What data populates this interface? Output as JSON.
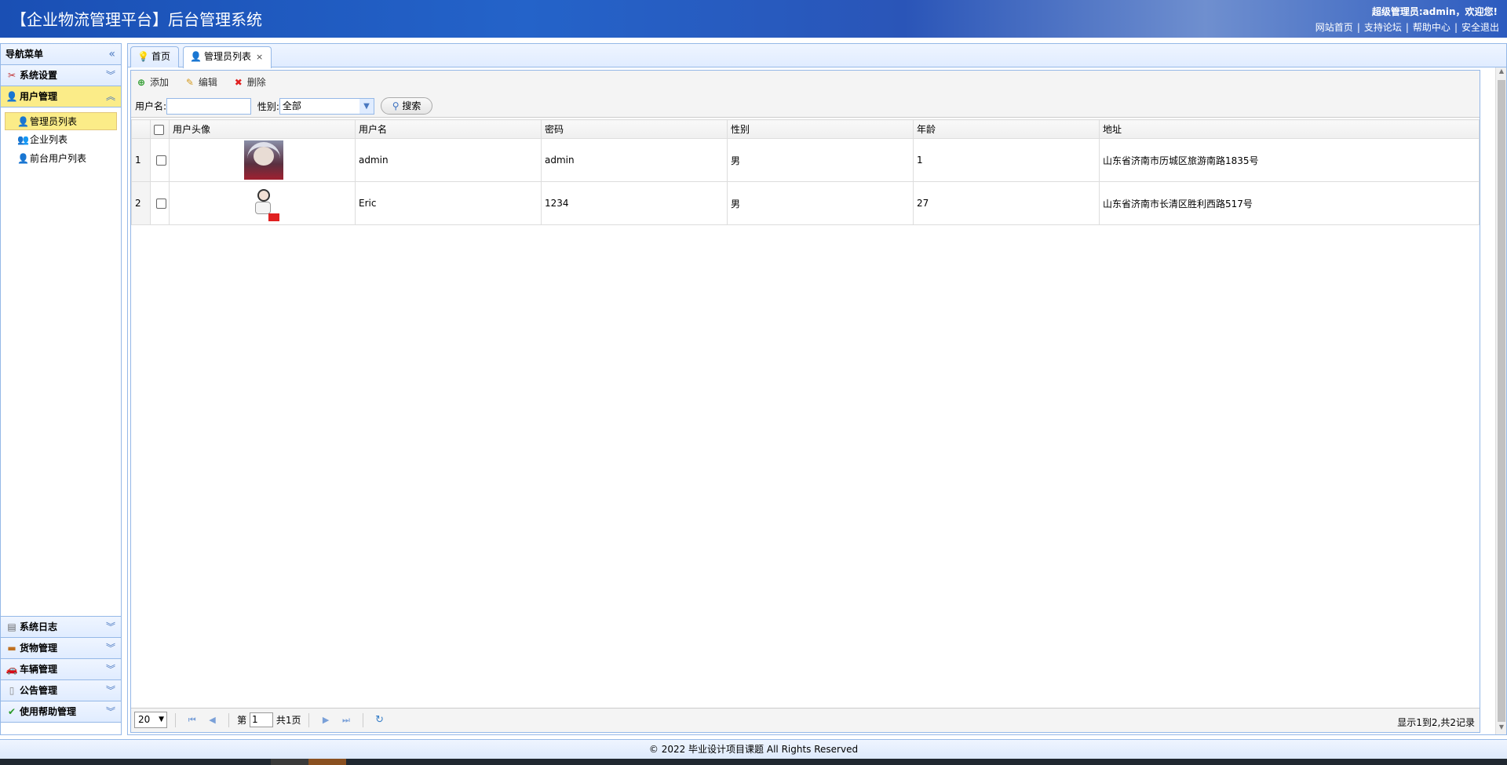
{
  "header": {
    "title": "【企业物流管理平台】后台管理系统",
    "welcome": "超级管理员:admin，欢迎您!",
    "links": [
      "网站首页",
      "支持论坛",
      "帮助中心",
      "安全退出"
    ]
  },
  "sidebar": {
    "title": "导航菜单",
    "sections": [
      {
        "label": "系统设置"
      },
      {
        "label": "用户管理"
      }
    ],
    "tree_items": [
      "管理员列表",
      "企业列表",
      "前台用户列表"
    ],
    "bottom_sections": [
      {
        "label": "系统日志"
      },
      {
        "label": "货物管理"
      },
      {
        "label": "车辆管理"
      },
      {
        "label": "公告管理"
      },
      {
        "label": "使用帮助管理"
      }
    ]
  },
  "tabs": [
    {
      "label": "首页"
    },
    {
      "label": "管理员列表"
    }
  ],
  "toolbar": {
    "add": "添加",
    "edit": "编辑",
    "delete": "删除"
  },
  "search": {
    "username_label": "用户名:",
    "username_value": "",
    "gender_label": "性别:",
    "gender_value": "全部",
    "button": "搜索"
  },
  "grid": {
    "columns": [
      "用户头像",
      "用户名",
      "密码",
      "性别",
      "年龄",
      "地址"
    ],
    "rows": [
      {
        "num": "1",
        "username": "admin",
        "password": "admin",
        "gender": "男",
        "age": "1",
        "address": "山东省济南市历城区旅游南路1835号"
      },
      {
        "num": "2",
        "username": "Eric",
        "password": "1234",
        "gender": "男",
        "age": "27",
        "address": "山东省济南市长清区胜利西路517号"
      }
    ]
  },
  "pager": {
    "page_size": "20",
    "page_prefix": "第",
    "page_number": "1",
    "page_total": "共1页",
    "info": "显示1到2,共2记录"
  },
  "footer": {
    "text": "© 2022 毕业设计项目课题 All Rights Reserved"
  }
}
